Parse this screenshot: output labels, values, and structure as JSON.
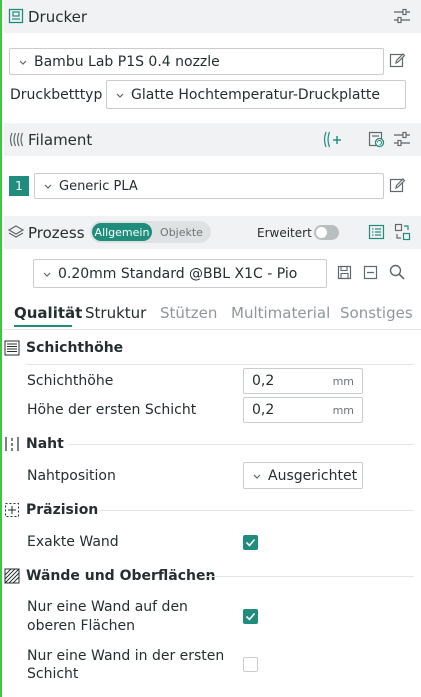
{
  "printer": {
    "title": "Drucker",
    "printer_value": "Bambu Lab P1S 0.4 nozzle",
    "bed_label": "Druckbetttyp",
    "bed_value": "Glatte Hochtemperatur-Druckplatte"
  },
  "filament": {
    "title": "Filament",
    "slot_number": "1",
    "value": "Generic PLA"
  },
  "process": {
    "title": "Prozess",
    "toggle_general": "Allgemein",
    "toggle_objects": "Objekte",
    "advanced_label": "Erweitert",
    "preset_value": "0.20mm Standard @BBL X1C - Pio"
  },
  "tabs": [
    "Qualität",
    "Struktur",
    "Stützen",
    "Multimaterial",
    "Sonstiges"
  ],
  "groups": {
    "layer_height": {
      "title": "Schichthöhe",
      "layer_height_label": "Schichthöhe",
      "layer_height_value": "0,2",
      "first_layer_label": "Höhe der ersten Schicht",
      "first_layer_value": "0,2",
      "unit": "mm"
    },
    "seam": {
      "title": "Naht",
      "position_label": "Nahtposition",
      "position_value": "Ausgerichtet"
    },
    "precision": {
      "title": "Präzision",
      "exact_wall_label": "Exakte Wand",
      "exact_wall_checked": true
    },
    "walls": {
      "title": "Wände und Oberflächen",
      "top_one_wall_label_1": "Nur eine Wand auf den",
      "top_one_wall_label_2": "oberen Flächen",
      "top_one_wall_checked": true,
      "first_one_wall_label_1": "Nur eine Wand in der ersten",
      "first_one_wall_label_2": "Schicht",
      "first_one_wall_checked": false
    }
  },
  "colors": {
    "accent": "#1f8c7c",
    "header_bg": "#f1f2f3",
    "active_edge": "#3ec83e"
  }
}
